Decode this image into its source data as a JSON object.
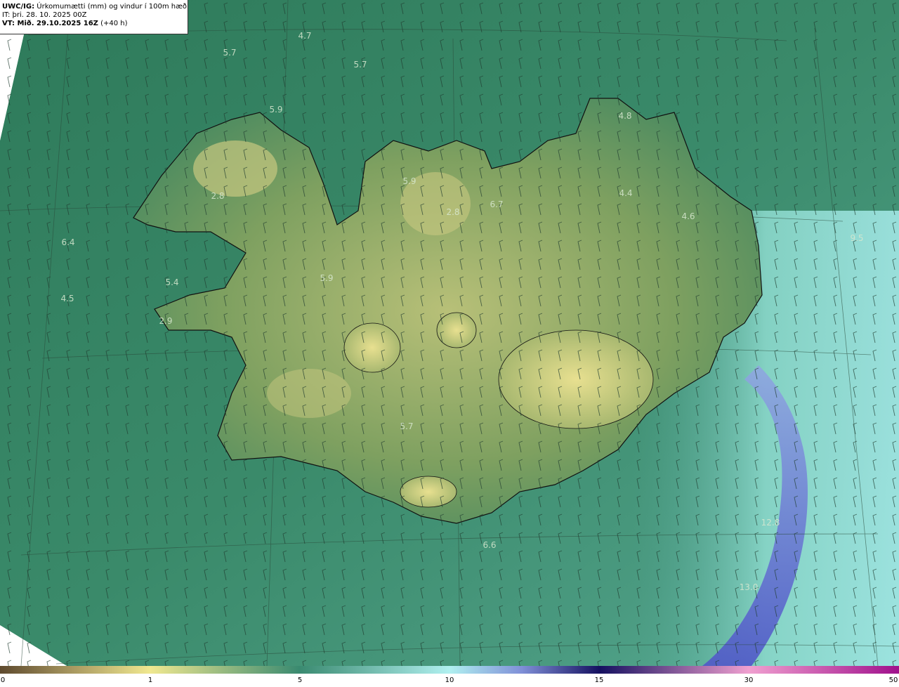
{
  "header": {
    "model": "UWC/IG:",
    "product": "Úrkomumætti (mm) og vindur í 100m hæð",
    "init_time": "IT: þri. 28. 10. 2025 00Z",
    "valid_prefix": "VT: Mið. 29.10.2025 16Z",
    "valid_suffix": "(+40 h)"
  },
  "colorbar": {
    "ticks": [
      "0",
      "1",
      "5",
      "10",
      "15",
      "30",
      "50"
    ],
    "colors": [
      "#5e4a2e",
      "#c0b070",
      "#f0e890",
      "#3a8a70",
      "#b0f0f0",
      "#7080d0",
      "#151060",
      "#f0a0d0",
      "#a0108c"
    ]
  },
  "map_labels": [
    "4.7",
    "5.7",
    "5.7",
    "5.9",
    "4.8",
    "5.9",
    "2.8",
    "6.7",
    "4.4",
    "2.8",
    "4.6",
    "9.5",
    "6.4",
    "5.4",
    "5.9",
    "4.5",
    "2.9",
    "5.7",
    "6.6",
    "12.8",
    "13.0"
  ]
}
